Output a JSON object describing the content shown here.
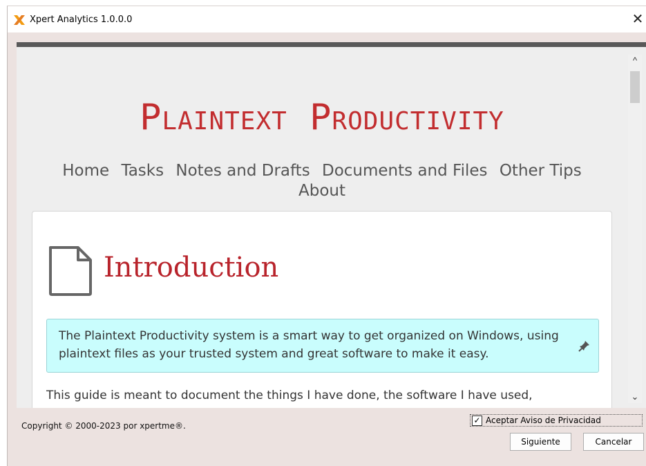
{
  "window": {
    "title": "Xpert Analytics 1.0.0.0",
    "close_symbol": "✕",
    "icon": "xpert-x-logo-icon"
  },
  "page": {
    "site_title": "Plaintext Productivity",
    "nav": [
      "Home",
      "Tasks",
      "Notes and Drafts",
      "Documents and Files",
      "Other Tips",
      "About"
    ],
    "heading": "Introduction",
    "heading_icon": "document-icon",
    "callout": "The Plaintext Productivity system is a smart way to get organized on Windows, using plaintext files as your trusted system and great software to make it easy.",
    "callout_icon": "pin-icon",
    "body_text": "This guide is meant to document the things I have done, the software I have used,"
  },
  "scrollbar": {
    "up_symbol": "^",
    "down_symbol": "⌄"
  },
  "footer": {
    "copyright": "Copyright © 2000-2023 por xpertme®.",
    "privacy_label": "Aceptar Aviso de Privacidad",
    "privacy_checked": true,
    "check_mark": "✓",
    "next_label": "Siguiente",
    "cancel_label": "Cancelar"
  },
  "colors": {
    "site_title": "#c22d2f",
    "heading": "#b8232b",
    "callout_bg": "#c9fdfd",
    "window_bg": "#ece2e0",
    "logo_orange": "#f39c12"
  }
}
